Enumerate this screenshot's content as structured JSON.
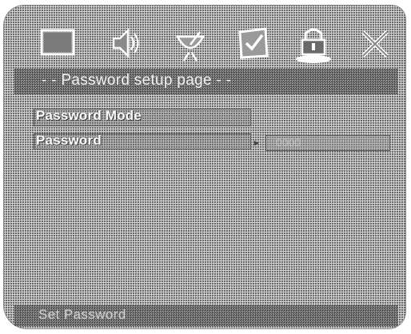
{
  "icons": [
    {
      "name": "general-setup-icon"
    },
    {
      "name": "audio-setup-icon"
    },
    {
      "name": "video-setup-icon"
    },
    {
      "name": "preference-setup-icon"
    },
    {
      "name": "password-setup-icon"
    },
    {
      "name": "exit-setup-icon"
    }
  ],
  "header": {
    "title": "- - Password setup page - -"
  },
  "settings": {
    "password_mode_label": "Password Mode",
    "password_label": "Password",
    "password_value": "0000"
  },
  "footer": {
    "status_text": "Set Password"
  }
}
